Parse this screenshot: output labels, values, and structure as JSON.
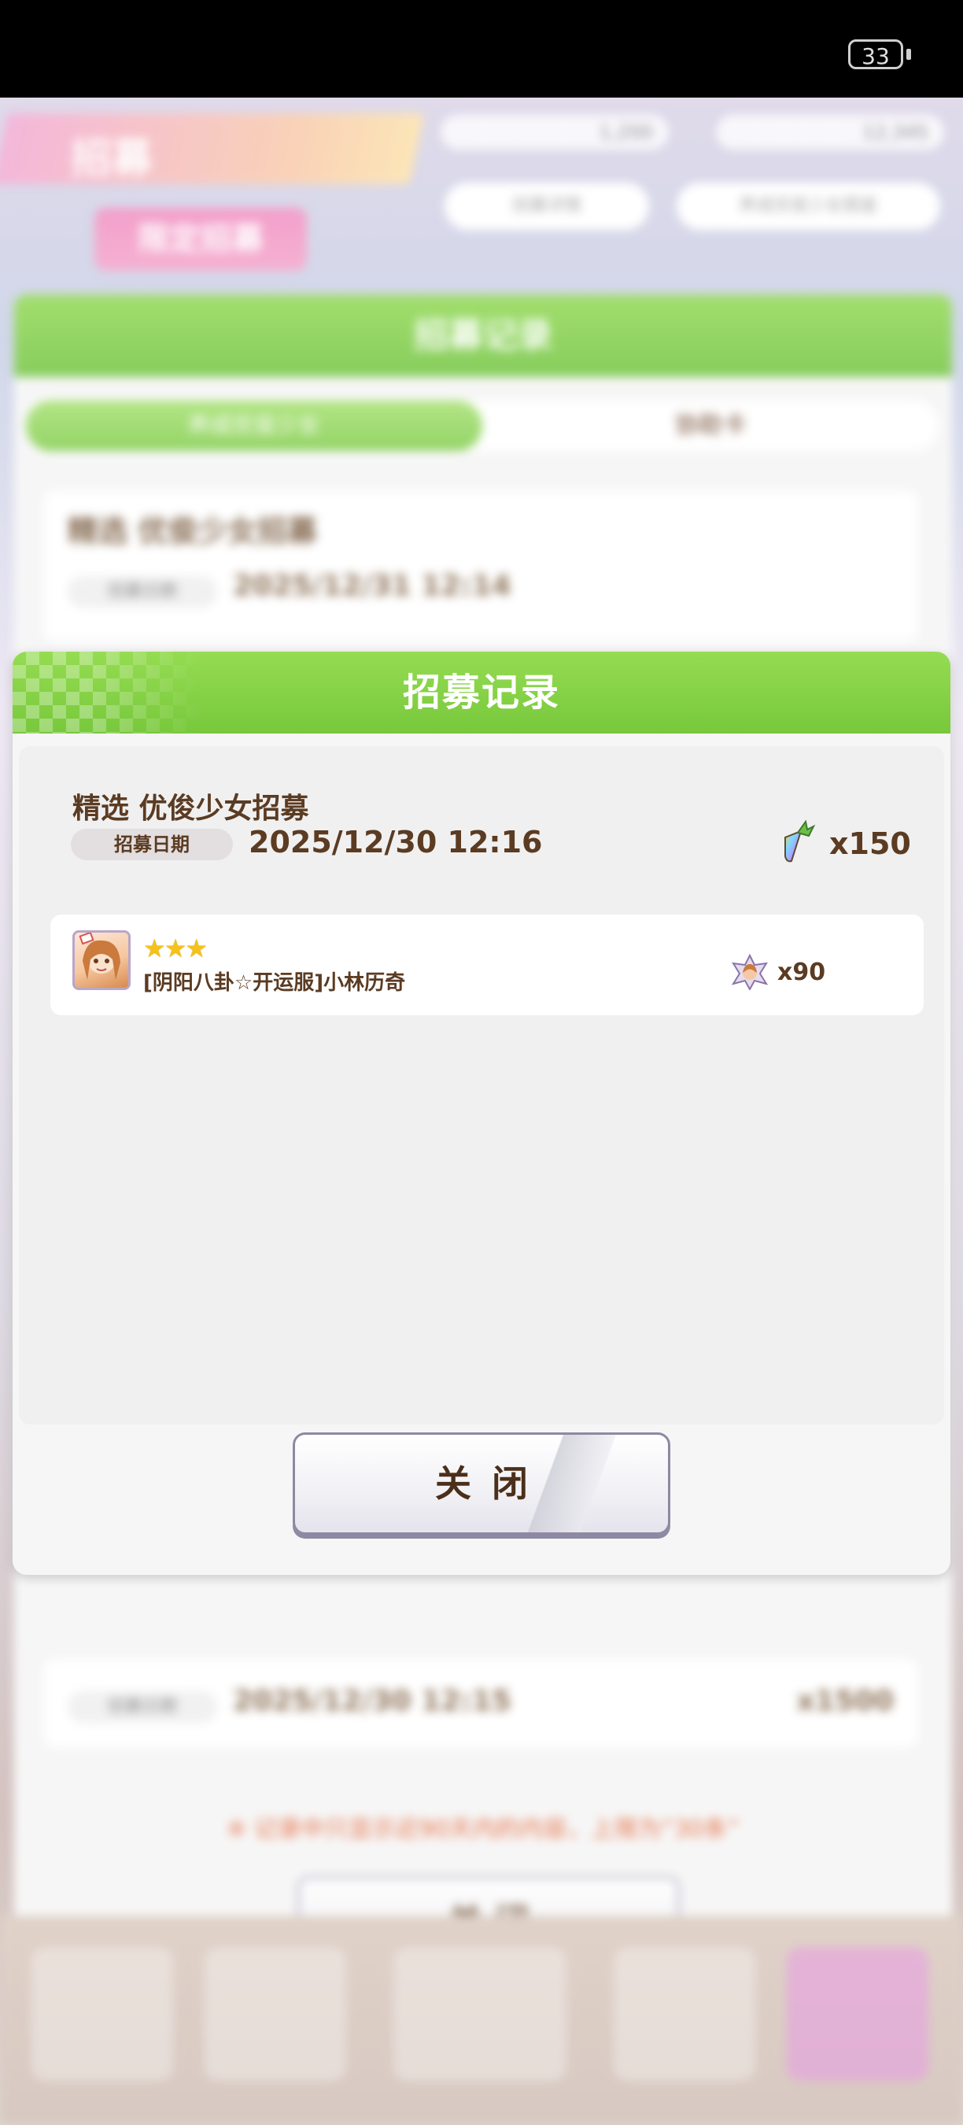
{
  "status_bar": {
    "battery": "33"
  },
  "background": {
    "header_title": "招募",
    "currency_1": "1,200",
    "currency_2": "12,345",
    "button_1": "招募详情",
    "button_2": "养成优俊少女图鉴",
    "badge": "限定招募",
    "panel_title": "招募记录",
    "tab_1": "养成优俊少女",
    "tab_2": "协助卡",
    "card_1_title": "精选 优俊少女招募",
    "card_1_date_label": "招募日期",
    "card_1_date": "2025/12/31 12:14",
    "card_2_date_label": "招募日期",
    "card_2_date": "2025/12/30 12:15",
    "card_2_amount": "x1500",
    "notice": "※ 记录中只显示近90天内的内容，上限为“30条”",
    "close": "关 闭"
  },
  "modal": {
    "title": "招募记录",
    "record": {
      "title": "精选  优俊少女招募",
      "date_label": "招募日期",
      "date": "2025/12/30  12:16",
      "cost": "x150",
      "cost_icon": "carrot-icon"
    },
    "results": [
      {
        "stars": "★★★",
        "name": "[阴阳八卦☆开运服]小林历奇",
        "piece_icon": "character-piece-icon",
        "amount": "x90"
      }
    ],
    "close_label": "关闭"
  },
  "colors": {
    "title_green": "#7cc93e",
    "text_brown": "#5b3b22",
    "star_gold": "#f4c21b"
  }
}
